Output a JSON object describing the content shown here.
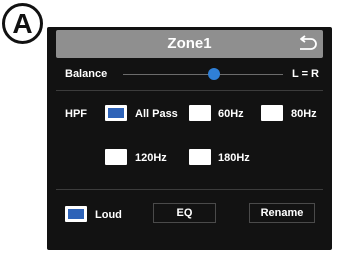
{
  "badge": "A",
  "header": {
    "title": "Zone1",
    "back_icon": "back-arrow-icon"
  },
  "balance": {
    "label": "Balance",
    "value_text": "L = R",
    "position": 0.57
  },
  "hpf": {
    "label": "HPF",
    "options": [
      {
        "label": "All Pass",
        "checked": true
      },
      {
        "label": "60Hz",
        "checked": false
      },
      {
        "label": "80Hz",
        "checked": false
      },
      {
        "label": "120Hz",
        "checked": false
      },
      {
        "label": "180Hz",
        "checked": false
      }
    ]
  },
  "footer": {
    "loud_label": "Loud",
    "loud_checked": true,
    "eq_label": "EQ",
    "rename_label": "Rename"
  },
  "colors": {
    "panel": "#121212",
    "header": "#8f8f8f",
    "accent": "#2e63b8",
    "slider_thumb": "#2f7fd6"
  }
}
